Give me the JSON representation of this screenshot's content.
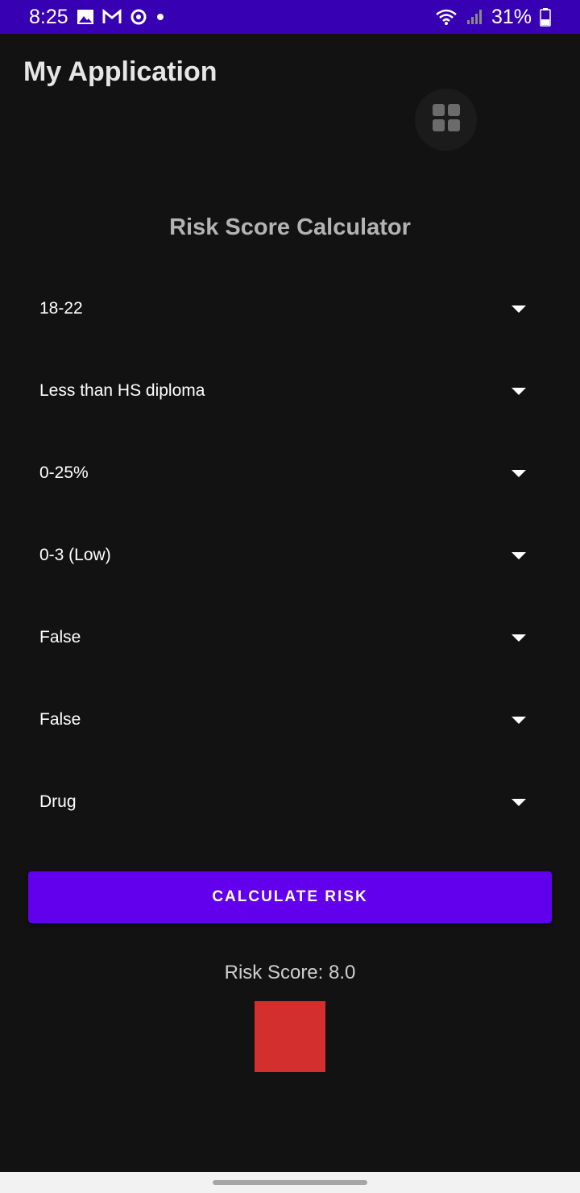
{
  "status_bar": {
    "time": "8:25",
    "battery": "31%",
    "left_icons": [
      "image-icon",
      "gmail-icon",
      "sync-icon",
      "dot-icon"
    ],
    "right_icons": [
      "wifi-icon",
      "signal-icon",
      "battery-icon"
    ]
  },
  "app": {
    "title": "My Application",
    "fab_icon": "grid-icon"
  },
  "calculator": {
    "heading": "Risk Score Calculator",
    "dropdowns": [
      {
        "value": "18-22"
      },
      {
        "value": "Less than HS diploma"
      },
      {
        "value": "0-25%"
      },
      {
        "value": "0-3 (Low)"
      },
      {
        "value": "False"
      },
      {
        "value": "False"
      },
      {
        "value": "Drug"
      }
    ],
    "button_label": "CALCULATE RISK",
    "result_text": "Risk Score: 8.0",
    "result_color": "#D32F2F"
  },
  "colors": {
    "status_bar": "#3700B3",
    "accent": "#6200EE",
    "background": "#121212"
  }
}
